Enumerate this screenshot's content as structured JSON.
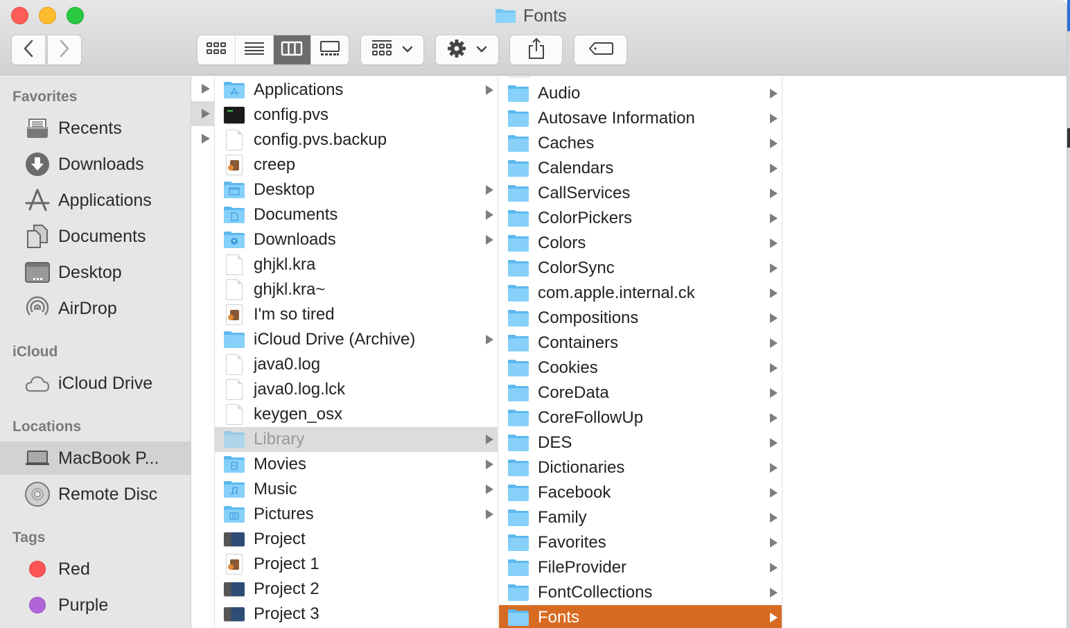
{
  "window": {
    "title": "Fonts",
    "title_icon": "folder-icon"
  },
  "toolbar": {
    "back": "chevron-left-icon",
    "forward": "chevron-right-icon",
    "view_modes": [
      {
        "name": "icon-view",
        "icon": "grid-icon",
        "active": false
      },
      {
        "name": "list-view",
        "icon": "list-icon",
        "active": false
      },
      {
        "name": "column-view",
        "icon": "columns-icon",
        "active": true
      },
      {
        "name": "gallery-view",
        "icon": "gallery-icon",
        "active": false
      }
    ],
    "group_button": "group-by-icon",
    "action_button": "gear-icon",
    "share_button": "share-icon",
    "tags_button": "tag-icon"
  },
  "sidebar": {
    "sections": [
      {
        "heading": "Favorites",
        "items": [
          {
            "label": "Recents",
            "icon": "recents-icon"
          },
          {
            "label": "Downloads",
            "icon": "downloads-icon"
          },
          {
            "label": "Applications",
            "icon": "applications-icon"
          },
          {
            "label": "Documents",
            "icon": "documents-icon"
          },
          {
            "label": "Desktop",
            "icon": "desktop-icon"
          },
          {
            "label": "AirDrop",
            "icon": "airdrop-icon"
          }
        ]
      },
      {
        "heading": "iCloud",
        "items": [
          {
            "label": "iCloud Drive",
            "icon": "cloud-icon"
          }
        ]
      },
      {
        "heading": "Locations",
        "items": [
          {
            "label": "MacBook P...",
            "icon": "laptop-icon",
            "selected": true
          },
          {
            "label": "Remote Disc",
            "icon": "disc-icon"
          }
        ]
      },
      {
        "heading": "Tags",
        "items": [
          {
            "label": "Red",
            "icon": "tag-dot-icon",
            "color": "#fd5656"
          },
          {
            "label": "Purple",
            "icon": "tag-dot-icon",
            "color": "#b064d8"
          }
        ]
      }
    ]
  },
  "columns": {
    "home": [
      {
        "name": "Applications",
        "type": "folder-apps",
        "expandable": true
      },
      {
        "name": "config.pvs",
        "type": "terminal"
      },
      {
        "name": "config.pvs.backup",
        "type": "doc"
      },
      {
        "name": "creep",
        "type": "garageband"
      },
      {
        "name": "Desktop",
        "type": "folder-desktop",
        "expandable": true
      },
      {
        "name": "Documents",
        "type": "folder-documents",
        "expandable": true
      },
      {
        "name": "Downloads",
        "type": "folder-downloads",
        "expandable": true
      },
      {
        "name": "ghjkl.kra",
        "type": "doc"
      },
      {
        "name": "ghjkl.kra~",
        "type": "doc"
      },
      {
        "name": "I'm so tired",
        "type": "garageband"
      },
      {
        "name": "iCloud Drive (Archive)",
        "type": "folder",
        "expandable": true
      },
      {
        "name": "java0.log",
        "type": "doc"
      },
      {
        "name": "java0.log.lck",
        "type": "doc"
      },
      {
        "name": "keygen_osx",
        "type": "doc"
      },
      {
        "name": "Library",
        "type": "folder-library",
        "expandable": true,
        "selected_inactive": true
      },
      {
        "name": "Movies",
        "type": "folder-movies",
        "expandable": true
      },
      {
        "name": "Music",
        "type": "folder-music",
        "expandable": true
      },
      {
        "name": "Pictures",
        "type": "folder-pictures",
        "expandable": true
      },
      {
        "name": "Project",
        "type": "project"
      },
      {
        "name": "Project 1",
        "type": "garageband"
      },
      {
        "name": "Project 2",
        "type": "project"
      },
      {
        "name": "Project 3",
        "type": "project"
      }
    ],
    "library": [
      {
        "name": "Audio"
      },
      {
        "name": "Autosave Information"
      },
      {
        "name": "Caches"
      },
      {
        "name": "Calendars"
      },
      {
        "name": "CallServices"
      },
      {
        "name": "ColorPickers"
      },
      {
        "name": "Colors"
      },
      {
        "name": "ColorSync"
      },
      {
        "name": "com.apple.internal.ck"
      },
      {
        "name": "Compositions"
      },
      {
        "name": "Containers"
      },
      {
        "name": "Cookies"
      },
      {
        "name": "CoreData"
      },
      {
        "name": "CoreFollowUp"
      },
      {
        "name": "DES"
      },
      {
        "name": "Dictionaries"
      },
      {
        "name": "Facebook"
      },
      {
        "name": "Family"
      },
      {
        "name": "Favorites"
      },
      {
        "name": "FileProvider"
      },
      {
        "name": "FontCollections"
      },
      {
        "name": "Fonts",
        "selected": true
      }
    ]
  },
  "colors": {
    "selection_accent": "#d86b22",
    "folder_blue": "#6cc4f5"
  }
}
